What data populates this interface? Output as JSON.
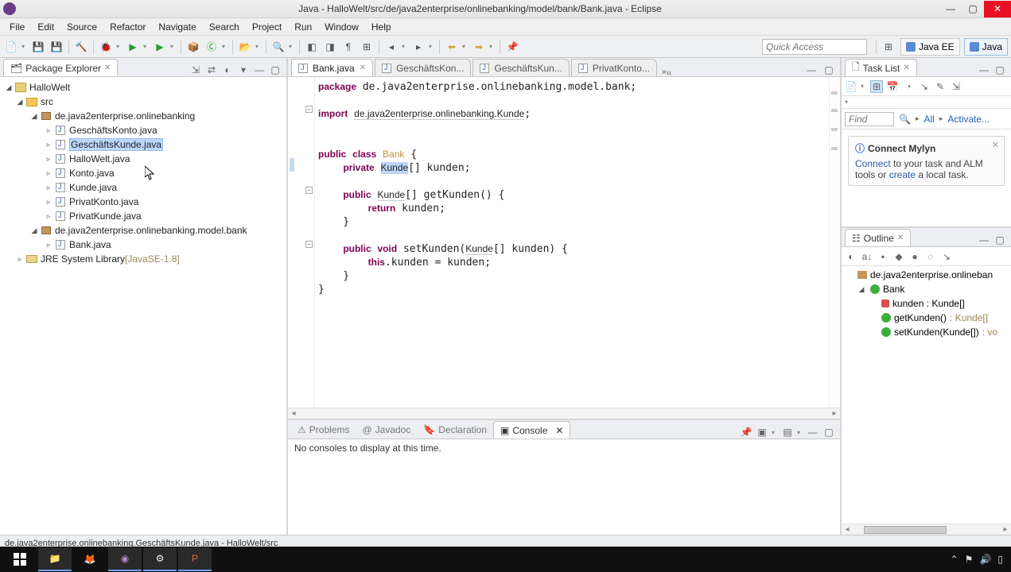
{
  "window": {
    "title": "Java - HalloWelt/src/de/java2enterprise/onlinebanking/model/bank/Bank.java - Eclipse"
  },
  "menubar": [
    "File",
    "Edit",
    "Source",
    "Refactor",
    "Navigate",
    "Search",
    "Project",
    "Run",
    "Window",
    "Help"
  ],
  "quick_access_placeholder": "Quick Access",
  "perspectives": {
    "left": "Java EE",
    "right": "Java"
  },
  "package_explorer": {
    "title": "Package Explorer",
    "project": "HalloWelt",
    "src": "src",
    "pkg1": "de.java2enterprise.onlinebanking",
    "pkg1_files": [
      "GeschäftsKonto.java",
      "GeschäftsKunde.java",
      "HalloWelt.java",
      "Konto.java",
      "Kunde.java",
      "PrivatKonto.java",
      "PrivatKunde.java"
    ],
    "pkg2": "de.java2enterprise.onlinebanking.model.bank",
    "pkg2_files": [
      "Bank.java"
    ],
    "jre": "JRE System Library",
    "jre_extra": "[JavaSE-1.8]",
    "selected_file_index": 1
  },
  "editor": {
    "tabs": [
      {
        "label": "Bank.java",
        "active": true
      },
      {
        "label": "GeschäftsKon...",
        "active": false
      },
      {
        "label": "GeschäftsKun...",
        "active": false
      },
      {
        "label": "PrivatKonto...",
        "active": false
      }
    ],
    "overflow": "»₁₁"
  },
  "tasklist": {
    "title": "Task List",
    "find_placeholder": "Find",
    "all": "All",
    "activate": "Activate...",
    "mylyn_title": "Connect Mylyn",
    "mylyn_connect": "Connect",
    "mylyn_text1": " to your task and ALM tools or ",
    "mylyn_create": "create",
    "mylyn_text2": " a local task."
  },
  "outline": {
    "title": "Outline",
    "pkg": "de.java2enterprise.onlineban",
    "class": "Bank",
    "items": [
      {
        "kind": "priv",
        "label": "kunden : Kunde[]"
      },
      {
        "kind": "pub",
        "label": "getKunden()",
        "ret": " : Kunde[]"
      },
      {
        "kind": "pub",
        "label": "setKunden(Kunde[])",
        "ret": " : vo"
      }
    ]
  },
  "bottom": {
    "tabs": [
      "Problems",
      "Javadoc",
      "Declaration",
      "Console"
    ],
    "active_index": 3,
    "message": "No consoles to display at this time."
  },
  "statusbar": "de.java2enterprise.onlinebanking.GeschäftsKunde.java - HalloWelt/src"
}
